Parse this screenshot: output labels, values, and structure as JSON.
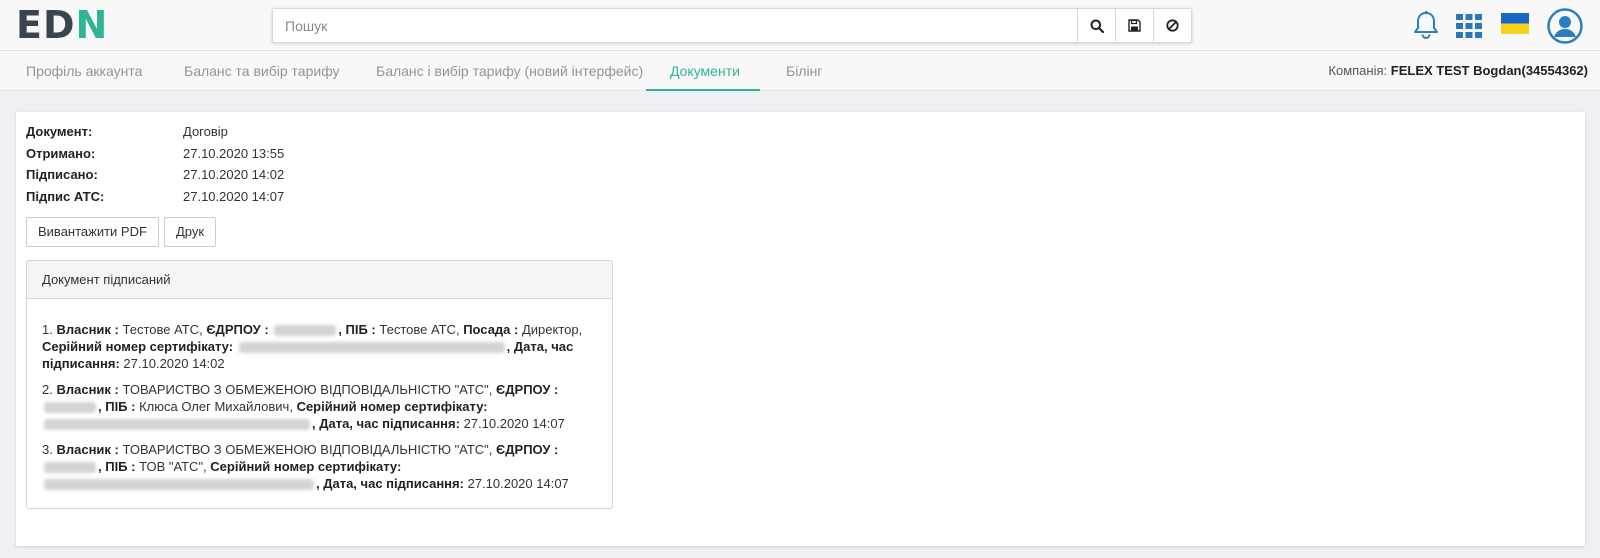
{
  "header": {
    "logo_dark": "ED",
    "logo_accent_1": "N",
    "logo_dark_2": "",
    "search_placeholder": "Пошук",
    "icons": [
      "search-icon",
      "save-icon",
      "clear-icon",
      "bell-icon",
      "apps-grid-icon",
      "ukraine-flag-icon",
      "user-avatar-icon"
    ],
    "accent_color": "#2fb595"
  },
  "tabs": [
    {
      "label": "Профіль аккаунта",
      "active": false
    },
    {
      "label": "Баланс та вибір тарифу",
      "active": false
    },
    {
      "label": "Баланс і вибір тарифу (новий інтерфейс)",
      "active": false
    },
    {
      "label": "Документи",
      "active": true
    },
    {
      "label": "Білінг",
      "active": false
    }
  ],
  "company": {
    "label": "Компанія:",
    "value": "FELEX TEST Bogdan(34554362)"
  },
  "document": {
    "fields": [
      {
        "key": "Документ:",
        "value": "Договір"
      },
      {
        "key": "Отримано:",
        "value": "27.10.2020 13:55"
      },
      {
        "key": "Підписано:",
        "value": "27.10.2020 14:02"
      },
      {
        "key": "Підпис АТС:",
        "value": "27.10.2020 14:07"
      }
    ],
    "download_pdf_label": "Вивантажити PDF",
    "print_label": "Друк"
  },
  "signatures": {
    "title": "Документ підписаний",
    "items": [
      {
        "num": "1.",
        "owner_label": "Власник :",
        "owner": "Тестове АТС,",
        "edrpou_label": "ЄДРПОУ :",
        "pib_label": ", ПІБ :",
        "pib": "Тестове АТС,",
        "position_label": "Посада :",
        "position": "Директор,",
        "serial_label": "Серійний номер сертифікату:",
        "datetime_label": ", Дата, час підписання:",
        "datetime": "27.10.2020 14:02"
      },
      {
        "num": "2.",
        "owner_label": "Власник :",
        "owner": "ТОВАРИСТВО З ОБМЕЖЕНОЮ ВІДПОВІДАЛЬНІСТЮ \"АТС\",",
        "edrpou_label": "ЄДРПОУ :",
        "pib_label": ", ПІБ :",
        "pib": "Клюса Олег Михайлович,",
        "serial_label": "Серійний номер сертифікату:",
        "datetime_label": ", Дата, час підписання:",
        "datetime": "27.10.2020 14:07"
      },
      {
        "num": "3.",
        "owner_label": "Власник :",
        "owner": "ТОВАРИСТВО З ОБМЕЖЕНОЮ ВІДПОВІДАЛЬНІСТЮ \"АТС\",",
        "edrpou_label": "ЄДРПОУ :",
        "pib_label": ", ПІБ :",
        "pib": "ТОВ \"АТС\",",
        "serial_label": "Серійний номер сертифікату:",
        "datetime_label": ", Дата, час підписання:",
        "datetime": "27.10.2020 14:07"
      }
    ]
  }
}
